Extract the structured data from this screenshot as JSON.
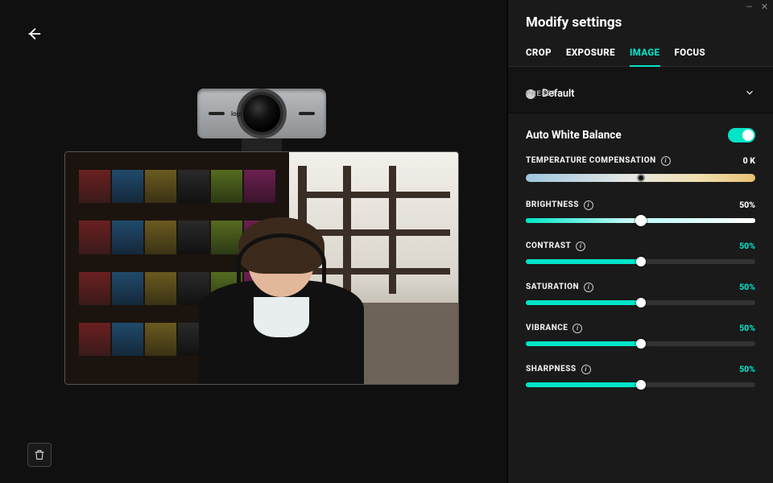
{
  "webcam_brand": "logi",
  "panel": {
    "title": "Modify settings",
    "tabs": [
      "CROP",
      "EXPOSURE",
      "IMAGE",
      "FOCUS"
    ],
    "active_tab": "IMAGE"
  },
  "preset": {
    "label": "PRESET",
    "name": "Default"
  },
  "auto_white_balance": {
    "label": "Auto White Balance",
    "enabled": true
  },
  "temperature": {
    "label": "TEMPERATURE COMPENSATION",
    "value_text": "0 K",
    "position_pct": 50
  },
  "sliders": [
    {
      "key": "brightness",
      "label": "BRIGHTNESS",
      "value_text": "50%",
      "value_pct": 50,
      "val_teal": false,
      "bright_style": true
    },
    {
      "key": "contrast",
      "label": "CONTRAST",
      "value_text": "50%",
      "value_pct": 50,
      "val_teal": true,
      "bright_style": false
    },
    {
      "key": "saturation",
      "label": "SATURATION",
      "value_text": "50%",
      "value_pct": 50,
      "val_teal": true,
      "bright_style": false
    },
    {
      "key": "vibrance",
      "label": "VIBRANCE",
      "value_text": "50%",
      "value_pct": 50,
      "val_teal": true,
      "bright_style": false
    },
    {
      "key": "sharpness",
      "label": "SHARPNESS",
      "value_text": "50%",
      "value_pct": 50,
      "val_teal": true,
      "bright_style": false
    }
  ]
}
